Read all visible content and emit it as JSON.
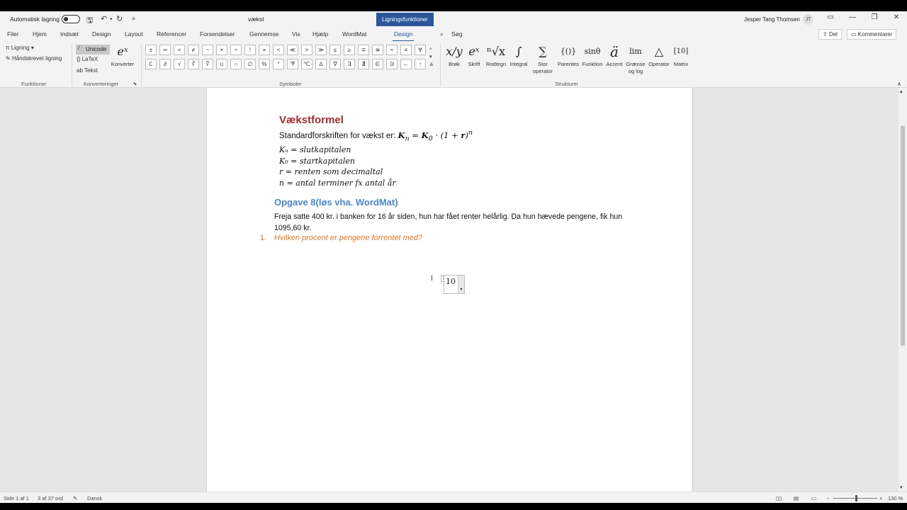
{
  "titlebar": {
    "autosave_label": "Automatisk lagring",
    "doc_title": "vækst",
    "context_tab": "Ligningsfunktioner",
    "user_name": "Jesper Tang Thomsen",
    "user_initials": "JT"
  },
  "tabs": [
    "Filer",
    "Hjem",
    "Indsæt",
    "Design",
    "Layout",
    "Referencer",
    "Forsendelser",
    "Gennemse",
    "Vis",
    "Hjælp",
    "WordMat",
    "Design"
  ],
  "active_tab_index": 11,
  "search_label": "Søg",
  "share_label": "Del",
  "comments_label": "Kommentarer",
  "ribbon": {
    "funktioner": {
      "ligning_label": "Ligning",
      "handwritten_label": "Håndskrevet ligning",
      "group_label": "Funktioner"
    },
    "konverteringer": {
      "unicode_label": "Unicode",
      "latex_label": "LaTeX",
      "tekst_label": "Tekst",
      "konverter_label": "Konverter",
      "group_label": "Konverteringer"
    },
    "symboler": {
      "row1": [
        "±",
        "∞",
        "=",
        "≠",
        "~",
        "×",
        "÷",
        "!",
        "∝",
        "<",
        "≪",
        ">",
        "≫",
        "≤",
        "≥",
        "∓",
        "≅",
        "≈",
        "≡",
        "∀"
      ],
      "row2": [
        "∁",
        "∂",
        "√",
        "∛",
        "∜",
        "∪",
        "∩",
        "∅",
        "%",
        "°",
        "℉",
        "℃",
        "∆",
        "∇",
        "∃",
        "∄",
        "∈",
        "∋",
        "←",
        "↑"
      ],
      "group_label": "Symboler"
    },
    "strukturer": {
      "items": [
        {
          "glyph": "x/y",
          "label": "Brøk"
        },
        {
          "glyph": "eˣ",
          "label": "Skrift"
        },
        {
          "glyph": "ⁿ√x",
          "label": "Rodtegn"
        },
        {
          "glyph": "∫",
          "label": "Integral"
        },
        {
          "glyph": "∑",
          "label": "Stor operator"
        },
        {
          "glyph": "{()}",
          "label": "Parentes"
        },
        {
          "glyph": "sinθ",
          "label": "Funktion"
        },
        {
          "glyph": "ä",
          "label": "Accent"
        },
        {
          "glyph": "lim",
          "label": "Grænse og log"
        },
        {
          "glyph": "△",
          "label": "Operator"
        },
        {
          "glyph": "[10]",
          "label": "Matrix"
        }
      ],
      "group_label": "Strukturer"
    }
  },
  "document": {
    "heading1": "Vækstformel",
    "standard_prefix": "Standardforskriften for vækst er: ",
    "definitions": [
      "Kₙ = slutkapitalen",
      "K₀ = startkapitalen",
      "r = renten som decimaltal",
      "n = antal terminer fx antal år"
    ],
    "heading2": "Opgave 8(løs vha. WordMat)",
    "body": "Freja satte 400 kr. i banken for 16 år siden, hun har fået renter helårlig. Da hun hævede pengene, fik hun 1095,60 kr.",
    "question_number": "1.",
    "question": "Hvilken procent er pengene forrentet med?",
    "equation_value": "10"
  },
  "statusbar": {
    "page": "Side 1 af 1",
    "words": "3 af 37 ord",
    "language": "Dansk",
    "zoom": "130 %"
  }
}
